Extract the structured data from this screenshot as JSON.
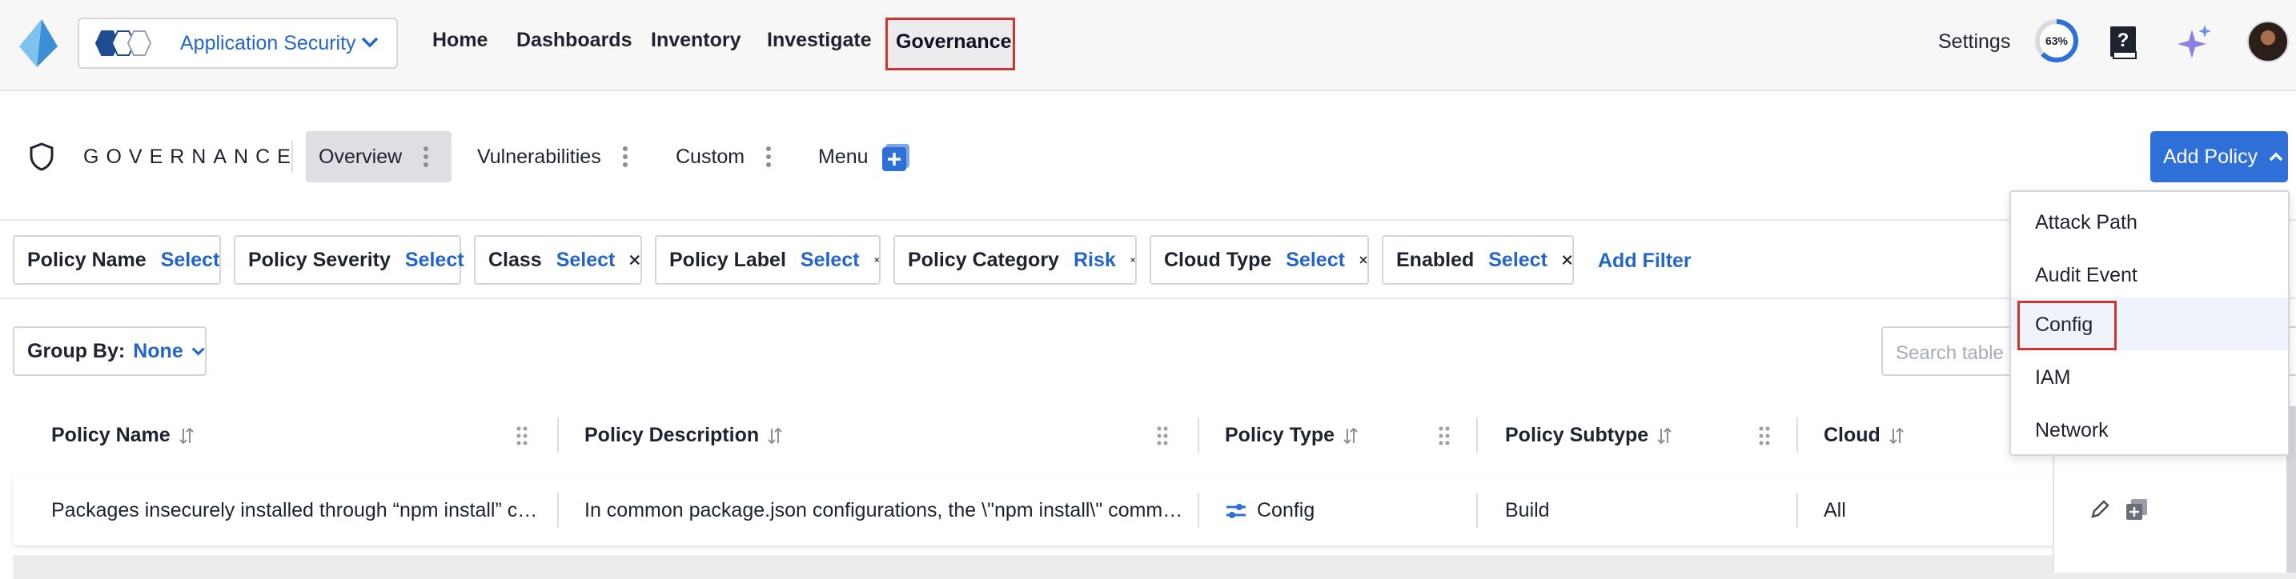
{
  "topnav": {
    "app_name": "Application Security",
    "items": [
      "Home",
      "Dashboards",
      "Inventory",
      "Investigate",
      "Governance"
    ],
    "settings_label": "Settings",
    "progress_label": "63%",
    "progress_value": 0.63,
    "icons": [
      "logo-icon",
      "hex-icon",
      "chevron-down-icon",
      "help-book-icon",
      "sparkle-icon",
      "avatar"
    ]
  },
  "tabs": {
    "section_title": "GOVERNANCE",
    "items": [
      "Overview",
      "Vulnerabilities",
      "Custom",
      "Menu"
    ],
    "add_policy_label": "Add Policy"
  },
  "filters": {
    "chips": [
      {
        "label": "Policy Name",
        "value": "Select"
      },
      {
        "label": "Policy Severity",
        "value": "Select"
      },
      {
        "label": "Class",
        "value": "Select"
      },
      {
        "label": "Policy Label",
        "value": "Select"
      },
      {
        "label": "Policy Category",
        "value": "Risk"
      },
      {
        "label": "Cloud Type",
        "value": "Select"
      },
      {
        "label": "Enabled",
        "value": "Select"
      }
    ],
    "add_filter_label": "Add Filter"
  },
  "group_by": {
    "label": "Group By:",
    "value": "None"
  },
  "search": {
    "placeholder": "Search table c"
  },
  "table": {
    "columns": [
      "Policy Name",
      "Policy Description",
      "Policy Type",
      "Policy Subtype",
      "Cloud"
    ],
    "rows": [
      {
        "name": "Packages insecurely installed through “npm install” com...",
        "description": "In common package.json configurations, the \\\"npm install\\\" command...",
        "type": "Config",
        "subtype": "Build",
        "cloud": "All"
      }
    ]
  },
  "dropdown": {
    "items": [
      "Attack Path",
      "Audit Event",
      "Config",
      "IAM",
      "Network"
    ],
    "highlighted": "Config"
  },
  "colors": {
    "accent": "#2466c8",
    "button": "#2e6fd8",
    "highlight_box": "#d0342c"
  }
}
